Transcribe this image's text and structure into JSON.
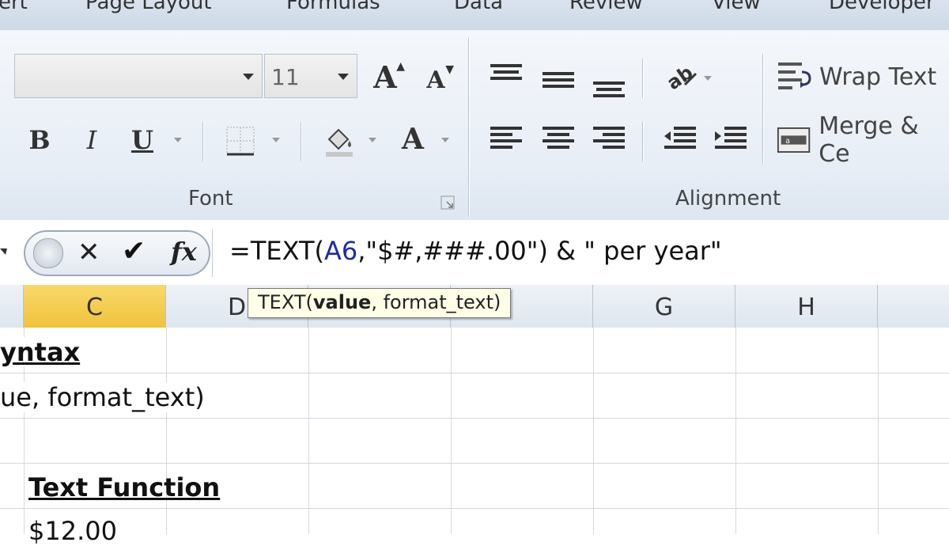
{
  "tabs": [
    "ert",
    "Page Layout",
    "Formulas",
    "Data",
    "Review",
    "View",
    "Developer"
  ],
  "font_group": {
    "font_name_value": "",
    "font_size_value": "11",
    "label": "Font",
    "bold_label": "B",
    "italic_label": "I",
    "underline_label": "U",
    "font_color_label": "A",
    "grow_font_label": "A",
    "shrink_font_label": "A"
  },
  "alignment_group": {
    "label": "Alignment",
    "wrap_text_label": "Wrap Text",
    "merge_label": "Merge & Ce"
  },
  "formula_bar": {
    "cancel_glyph": "✕",
    "enter_glyph": "✔",
    "fx_label": "fx",
    "formula_prefix": "=TEXT(",
    "formula_ref": "A6",
    "formula_mid": ",\"$#,###.00\") ",
    "formula_amp": "&",
    "formula_suffix": " \" per year\""
  },
  "tooltip": {
    "func": "TEXT(",
    "arg_bold": "value",
    "rest": ", format_text)"
  },
  "columns": [
    "C",
    "D",
    "G",
    "H"
  ],
  "cells": {
    "syntax_heading": "yntax",
    "syntax_text": "ue, format_text)",
    "text_function_heading": "Text Function",
    "value_cell": "$12.00"
  },
  "colors": {
    "active_column": "#f0c23b",
    "cell_reference": "#1f2aa8",
    "tooltip_bg": "#ffffe8"
  }
}
